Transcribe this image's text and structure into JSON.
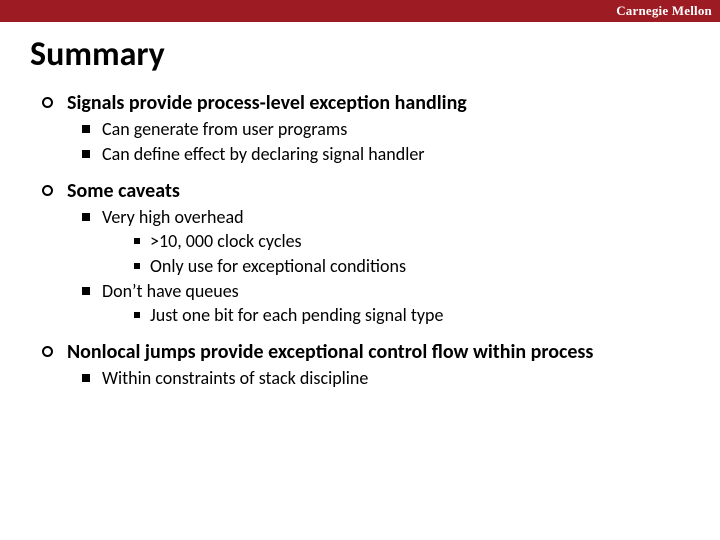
{
  "brand": "Carnegie Mellon",
  "title": "Summary",
  "b1": "Signals provide process-level exception handling",
  "b1s1": "Can generate from user programs",
  "b1s2": "Can define effect by declaring signal handler",
  "b2": "Some caveats",
  "b2s1": "Very high overhead",
  "b2s1a": ">10, 000 clock cycles",
  "b2s1b": "Only use for exceptional conditions",
  "b2s2": "Don’t have queues",
  "b2s2a": "Just one bit for each pending signal type",
  "b3": "Nonlocal jumps provide exceptional control flow within process",
  "b3s1": "Within constraints of stack discipline"
}
